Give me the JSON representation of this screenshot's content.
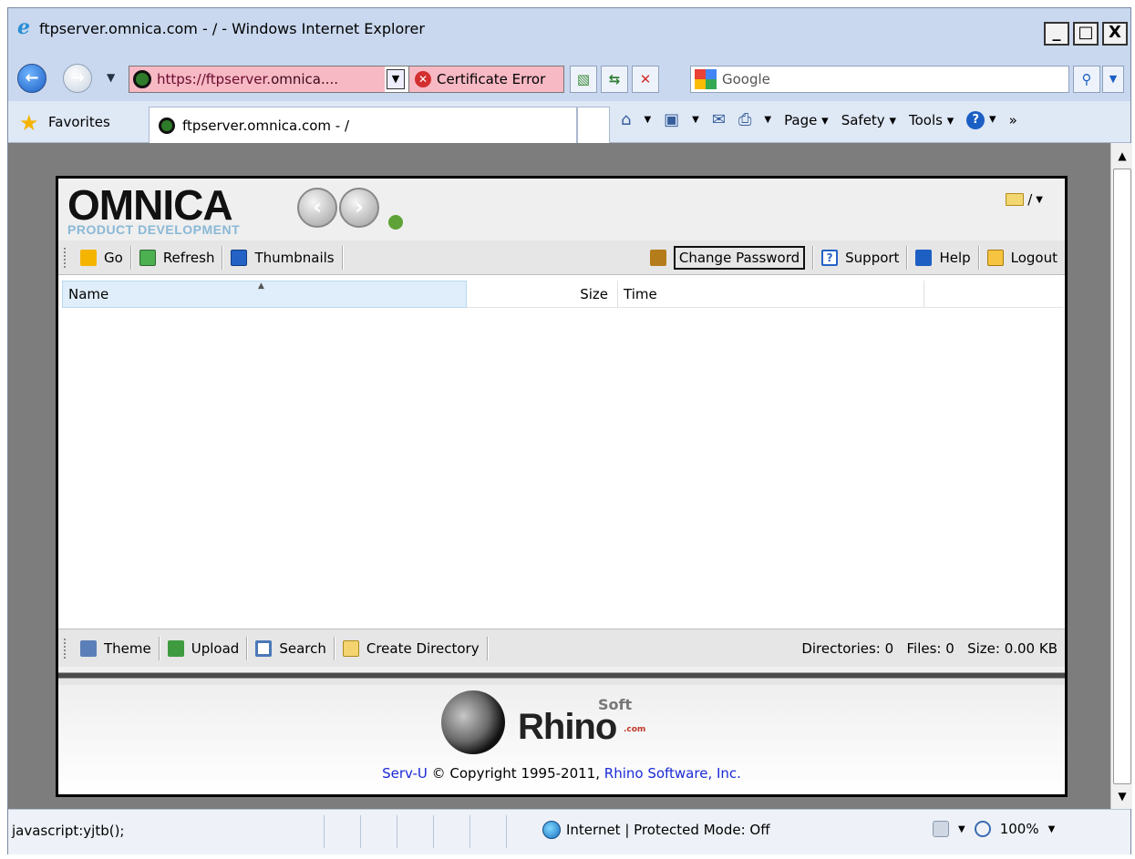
{
  "window": {
    "title": "ftpserver.omnica.com - / - Windows Internet Explorer",
    "buttons": [
      "_",
      "□",
      "X"
    ]
  },
  "addressbar": {
    "url_prefix": "https://ftpserver.",
    "url_host": "omnica....",
    "cert_error": "Certificate Error",
    "search_placeholder": "Google"
  },
  "favorites": {
    "label": "Favorites",
    "tab_title": "ftpserver.omnica.com - /"
  },
  "commandbar": {
    "page": "Page",
    "safety": "Safety",
    "tools": "Tools"
  },
  "app": {
    "logo_main": "OMNICA",
    "logo_sub": "PRODUCT DEVELOPMENT",
    "current_dir": "/",
    "toolbar": {
      "go": "Go",
      "refresh": "Refresh",
      "thumbnails": "Thumbnails",
      "change_password": "Change Password",
      "support": "Support",
      "help": "Help",
      "logout": "Logout"
    },
    "table": {
      "columns": [
        "Name",
        "Size",
        "Time",
        ""
      ],
      "rows": []
    },
    "bottom_toolbar": {
      "theme": "Theme",
      "upload": "Upload",
      "search": "Search",
      "create_directory": "Create Directory"
    },
    "stats": {
      "directories": "Directories: 0",
      "files": "Files: 0",
      "size": "Size: 0.00 KB"
    },
    "footer": {
      "brand_word": "Rhino",
      "brand_soft": "Soft",
      "brand_com": ".com",
      "product_link": "Serv-U",
      "copyright_text": " © Copyright 1995-2011, ",
      "company_link": "Rhino Software, Inc."
    }
  },
  "statusbar": {
    "text": "javascript:yjtb();",
    "zone": "Internet | Protected Mode: Off",
    "zoom": "100%"
  }
}
